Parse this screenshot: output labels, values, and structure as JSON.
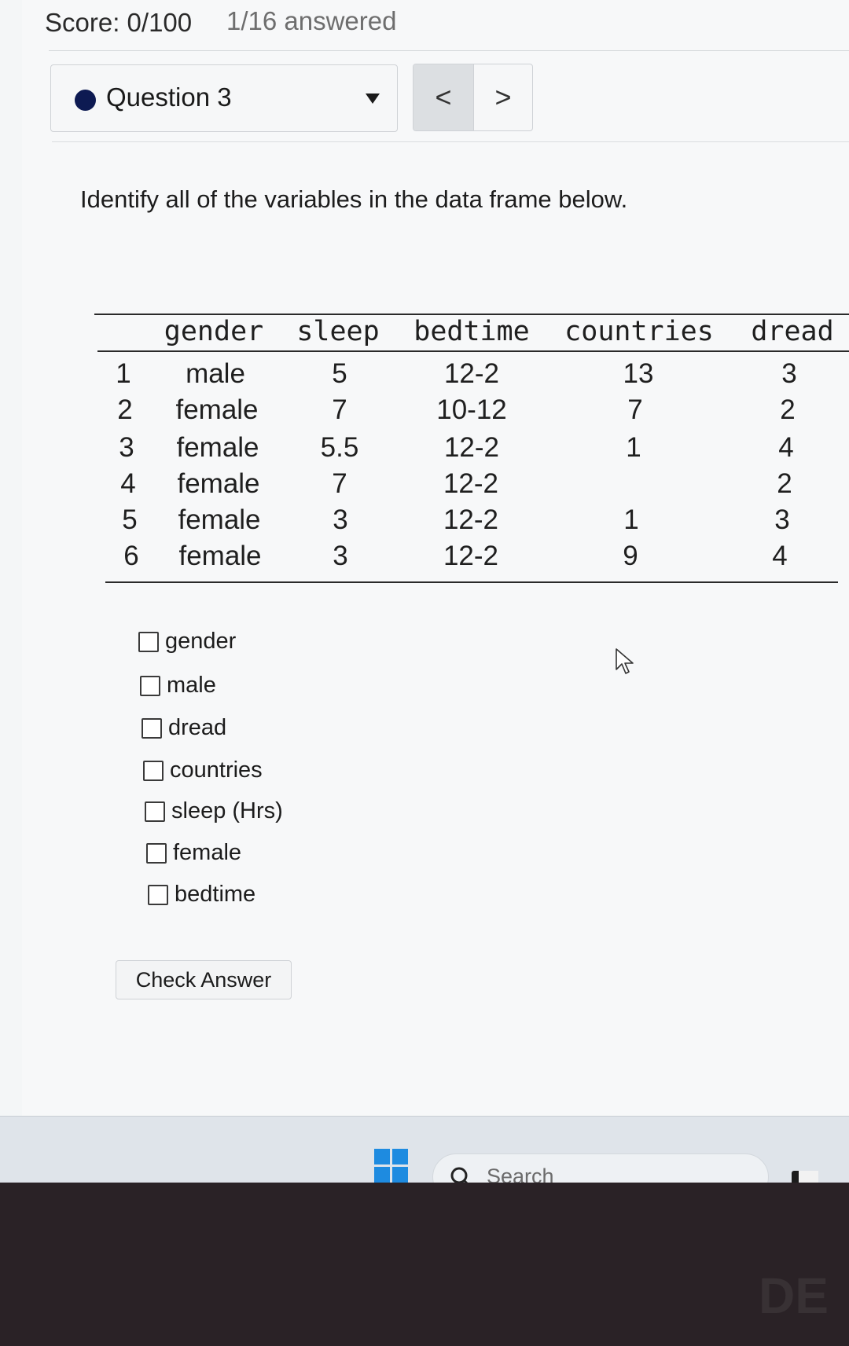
{
  "header": {
    "score": "Score: 0/100",
    "answered": "1/16 answered"
  },
  "question_select": {
    "label": "Question 3",
    "status_color": "#0d1a52"
  },
  "nav": {
    "prev": "<",
    "next": ">"
  },
  "prompt": "Identify all of the variables in the data frame below.",
  "table": {
    "columns": [
      "gender",
      "sleep",
      "bedtime",
      "countries",
      "dread"
    ],
    "rows": [
      [
        "1",
        "male",
        "5",
        "12-2",
        "13",
        "3"
      ],
      [
        "2",
        "female",
        "7",
        "10-12",
        "7",
        "2"
      ],
      [
        "3",
        "female",
        "5.5",
        "12-2",
        "1",
        "4"
      ],
      [
        "4",
        "female",
        "7",
        "12-2",
        "",
        "2"
      ],
      [
        "5",
        "female",
        "3",
        "12-2",
        "1",
        "3"
      ],
      [
        "6",
        "female",
        "3",
        "12-2",
        "9",
        "4"
      ]
    ]
  },
  "options": [
    {
      "label": "gender",
      "checked": false
    },
    {
      "label": "male",
      "checked": false
    },
    {
      "label": "dread",
      "checked": false
    },
    {
      "label": "countries",
      "checked": false
    },
    {
      "label": "sleep (Hrs)",
      "checked": false
    },
    {
      "label": "female",
      "checked": false
    },
    {
      "label": "bedtime",
      "checked": false
    }
  ],
  "check_button": "Check Answer",
  "taskbar": {
    "search_placeholder": "Search",
    "icons": [
      "windows-start-icon",
      "search-icon",
      "app-icon"
    ]
  },
  "bezel": {
    "logo_text": "DE"
  }
}
